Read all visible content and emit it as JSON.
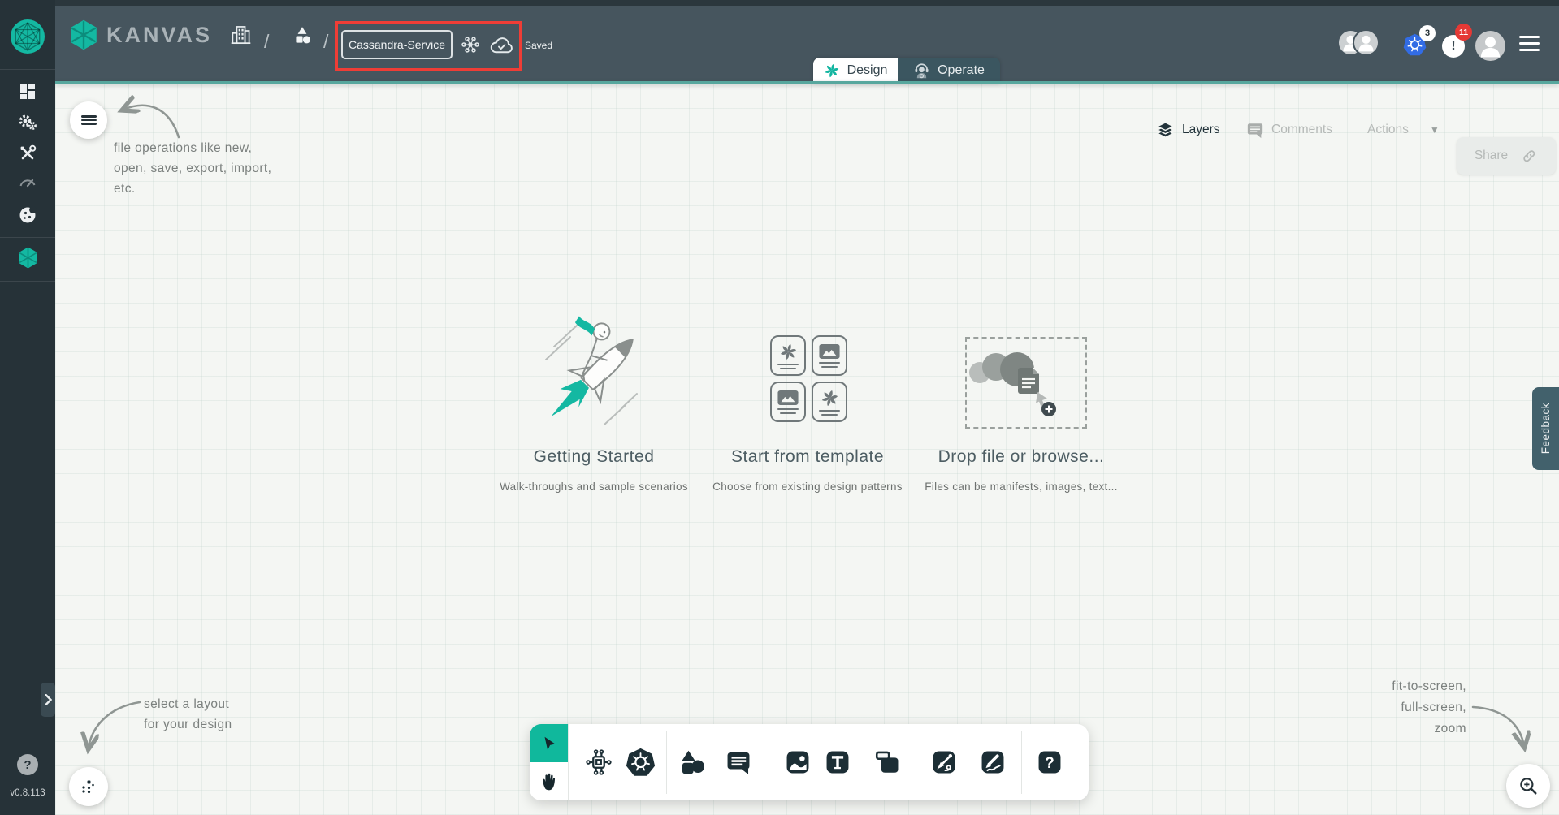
{
  "app": {
    "brand": "KANVAS",
    "version": "v0.8.113",
    "help_glyph": "?"
  },
  "colors": {
    "accent_teal": "#12b5a0",
    "sidebar": "#263238",
    "header": "#46555e",
    "danger_red": "#ef3d36",
    "kubernetes_blue": "#326ce5"
  },
  "header": {
    "file_name": "Cassandra-Service",
    "save_status": "Saved",
    "breadcrumb_separator": "/",
    "alert_glyph": "!",
    "tabs": {
      "design": "Design",
      "operate": "Operate"
    },
    "kubernetes_context_count": "3",
    "notification_count": "11"
  },
  "canvas_controls": {
    "layers": "Layers",
    "comments": "Comments",
    "actions": "Actions",
    "actions_caret": "▼",
    "share": "Share"
  },
  "cards": {
    "getting_started": {
      "title": "Getting Started",
      "subtitle": "Walk-throughs and sample scenarios"
    },
    "template": {
      "title": "Start from template",
      "subtitle": "Choose from existing design patterns"
    },
    "drop": {
      "title": "Drop file or browse...",
      "subtitle": "Files can be manifests, images, text..."
    }
  },
  "annotations": {
    "file_ops": [
      "file operations like new,",
      "open, save, export, import,",
      "etc."
    ],
    "layout": [
      "select a layout",
      "for your design"
    ],
    "view": [
      "fit-to-screen,",
      "full-screen,",
      "zoom"
    ]
  },
  "toolbar": {
    "tools": [
      "select",
      "pan",
      "component",
      "kubernetes",
      "shapes",
      "comment",
      "image",
      "text",
      "frame",
      "pen",
      "sketch",
      "help"
    ],
    "help_glyph": "?"
  },
  "feedback": {
    "label": "Feedback"
  }
}
